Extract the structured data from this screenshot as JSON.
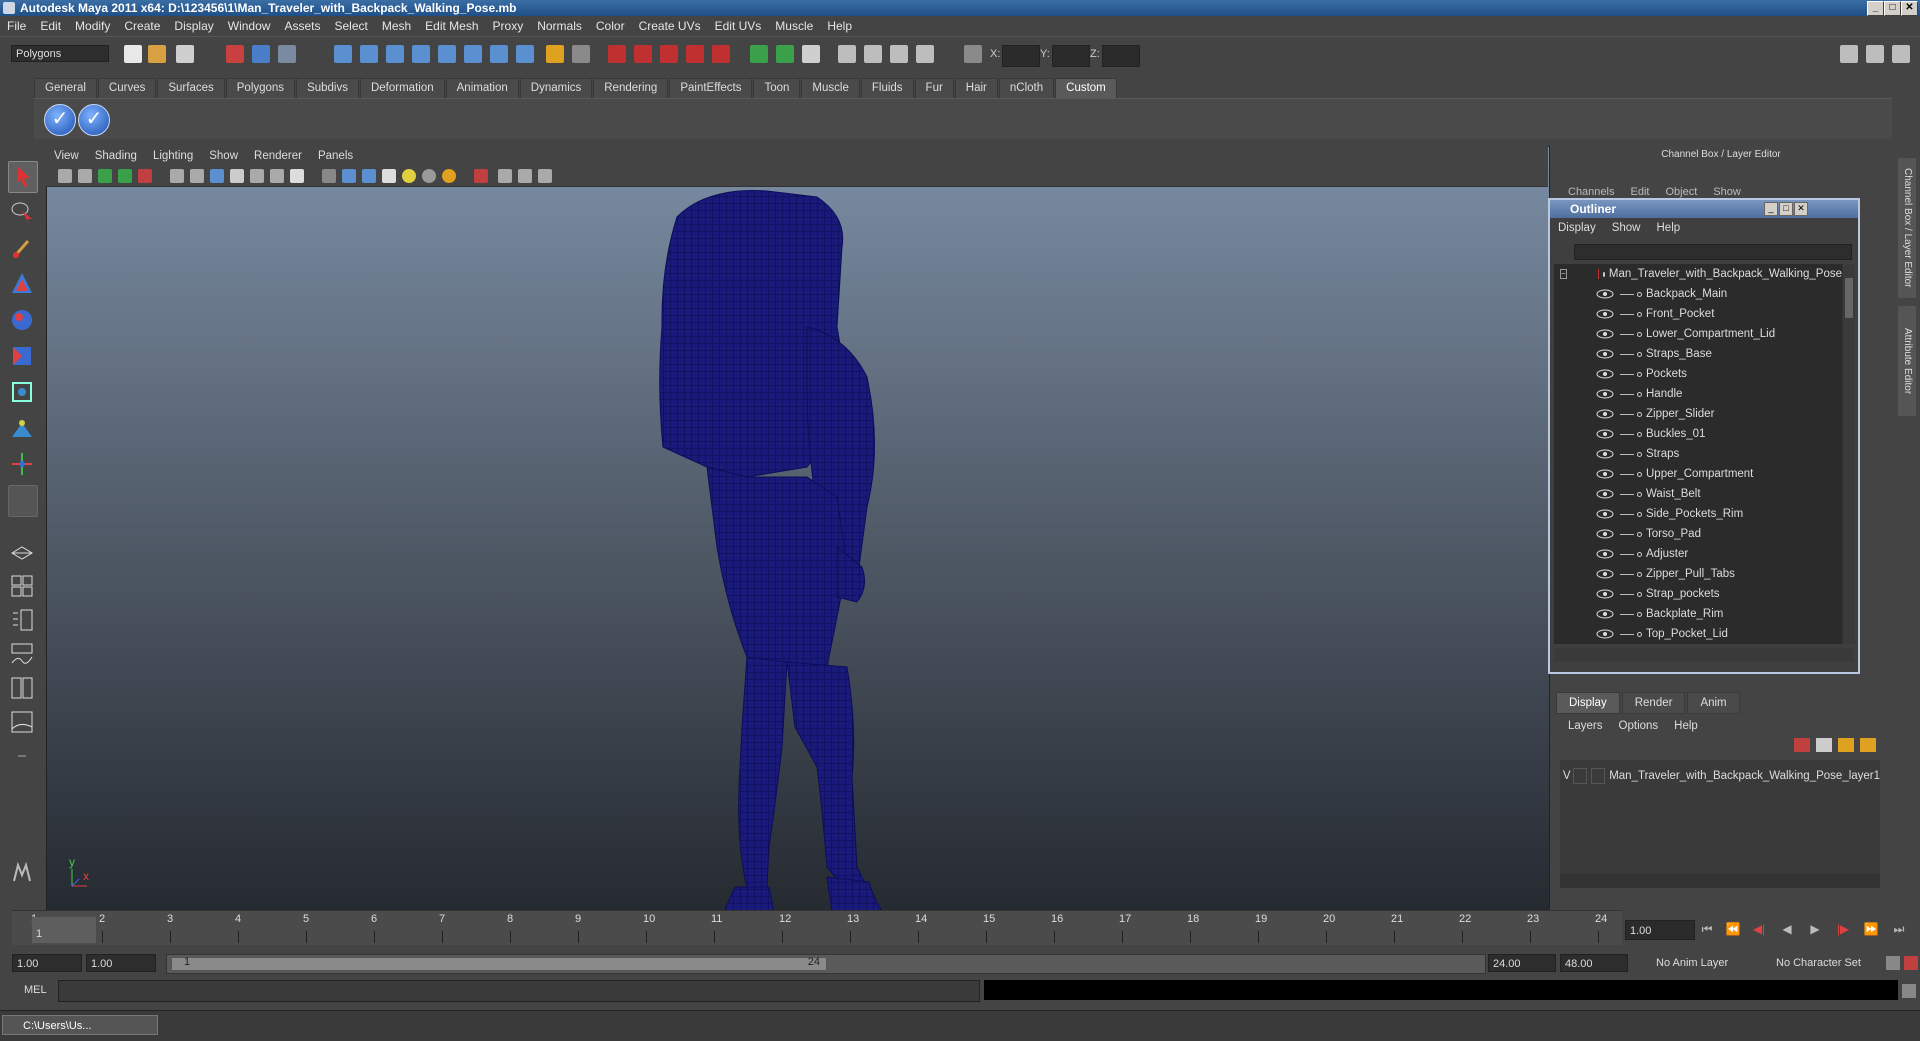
{
  "window": {
    "title": "Autodesk Maya 2011 x64: D:\\123456\\1\\Man_Traveler_with_Backpack_Walking_Pose.mb",
    "min": "_",
    "max": "□",
    "close": "✕"
  },
  "menubar": [
    "File",
    "Edit",
    "Modify",
    "Create",
    "Display",
    "Window",
    "Assets",
    "Select",
    "Mesh",
    "Edit Mesh",
    "Proxy",
    "Normals",
    "Color",
    "Create UVs",
    "Edit UVs",
    "Muscle",
    "Help"
  ],
  "statusline": {
    "mode": "Polygons",
    "x_label": "X:",
    "y_label": "Y:",
    "z_label": "Z:"
  },
  "shelf": {
    "tabs": [
      "General",
      "Curves",
      "Surfaces",
      "Polygons",
      "Subdivs",
      "Deformation",
      "Animation",
      "Dynamics",
      "Rendering",
      "PaintEffects",
      "Toon",
      "Muscle",
      "Fluids",
      "Fur",
      "Hair",
      "nCloth",
      "Custom"
    ],
    "active_tab": "Custom",
    "btn_glyph": "✓"
  },
  "viewport": {
    "menu": [
      "View",
      "Shading",
      "Lighting",
      "Show",
      "Renderer",
      "Panels"
    ],
    "axis_y": "y",
    "axis_x": "x"
  },
  "channel_box": {
    "title": "Channel Box / Layer Editor",
    "menu": [
      "Channels",
      "Edit",
      "Object",
      "Show"
    ]
  },
  "outliner": {
    "title": "Outliner",
    "menu": [
      "Display",
      "Show",
      "Help"
    ],
    "root": "Man_Traveler_with_Backpack_Walking_Pose",
    "items": [
      "Backpack_Main",
      "Front_Pocket",
      "Lower_Compartment_Lid",
      "Straps_Base",
      "Pockets",
      "Handle",
      "Zipper_Slider",
      "Buckles_01",
      "Straps",
      "Upper_Compartment",
      "Waist_Belt",
      "Side_Pockets_Rim",
      "Torso_Pad",
      "Adjuster",
      "Zipper_Pull_Tabs",
      "Strap_pockets",
      "Backplate_Rim",
      "Top_Pocket_Lid"
    ]
  },
  "layer_editor": {
    "tabs": [
      "Display",
      "Render",
      "Anim"
    ],
    "active_tab": "Display",
    "menu": [
      "Layers",
      "Options",
      "Help"
    ],
    "layer_v": "V",
    "layer_name": "Man_Traveler_with_Backpack_Walking_Pose_layer1"
  },
  "side_tabs": {
    "channel": "Channel Box / Layer Editor",
    "attribute": "Attribute Editor"
  },
  "timeslider": {
    "ticks": [
      "1",
      "2",
      "3",
      "4",
      "5",
      "6",
      "7",
      "8",
      "9",
      "10",
      "11",
      "12",
      "13",
      "14",
      "15",
      "16",
      "17",
      "18",
      "19",
      "20",
      "21",
      "22",
      "23",
      "24"
    ],
    "current_marker": "1",
    "current_frame": "1.00"
  },
  "range": {
    "start": "1.00",
    "playback_start": "1.00",
    "bar_start": "1",
    "bar_end": "24",
    "playback_end": "24.00",
    "end": "48.00",
    "anim_layer": "No Anim Layer",
    "character_set": "No Character Set"
  },
  "commandline": {
    "label": "MEL"
  },
  "taskbar": {
    "item": "C:\\Users\\Us..."
  }
}
